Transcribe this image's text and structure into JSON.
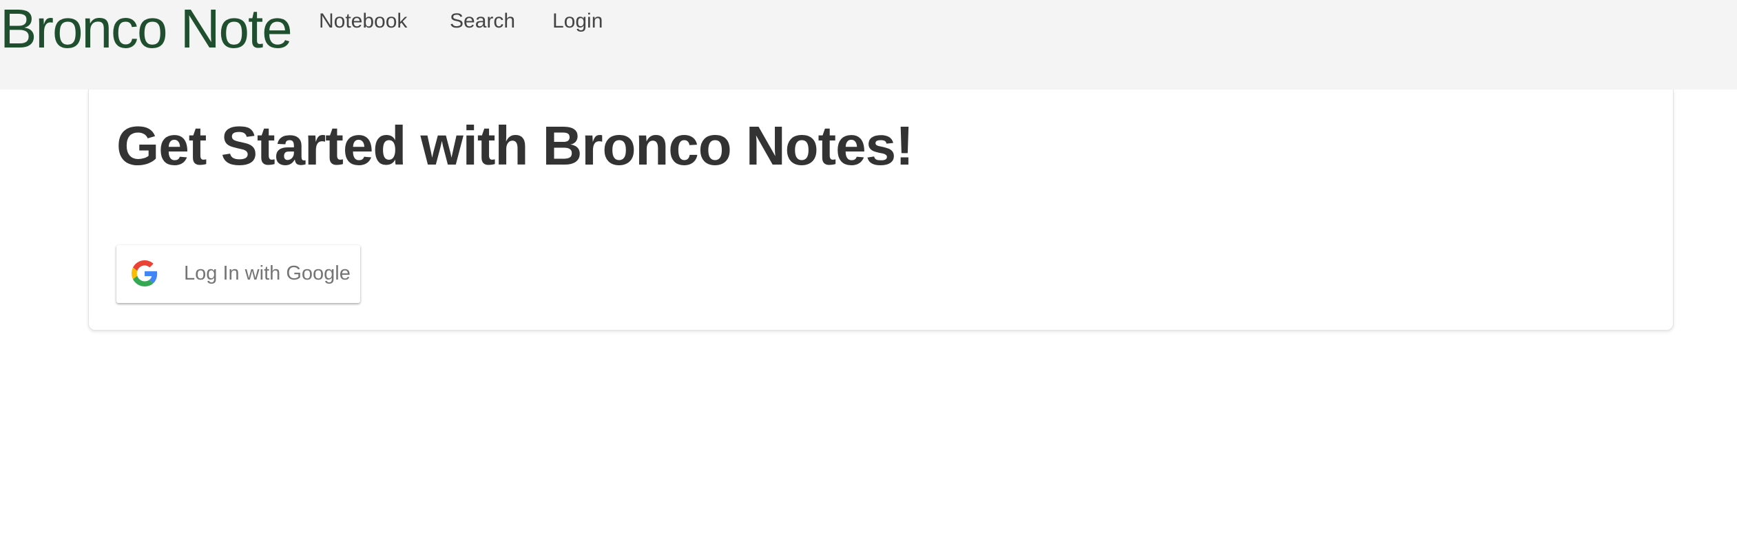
{
  "navbar": {
    "brand": "Bronco Note",
    "links": [
      {
        "label": "Notebook"
      },
      {
        "label": "Search"
      },
      {
        "label": "Login"
      }
    ],
    "brand_color": "#1f4f2e",
    "background_color": "#f4f4f4"
  },
  "main": {
    "title": "Get Started with Bronco Notes!",
    "google_button": {
      "label": "Log In with Google",
      "icon": "google-g-icon"
    }
  }
}
